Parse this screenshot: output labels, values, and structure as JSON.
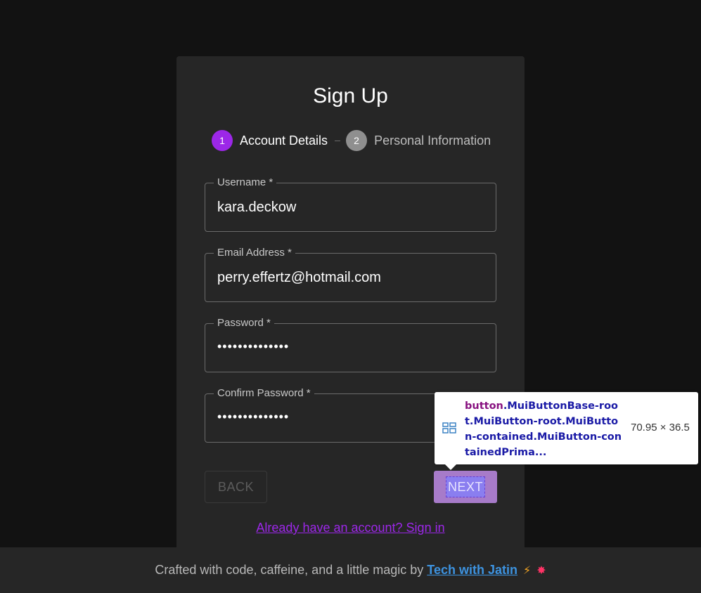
{
  "form": {
    "title": "Sign Up",
    "steps": [
      {
        "number": "1",
        "label": "Account Details"
      },
      {
        "number": "2",
        "label": "Personal Information"
      }
    ],
    "fields": {
      "username": {
        "label": "Username *",
        "value": "kara.deckow"
      },
      "email": {
        "label": "Email Address *",
        "value": "perry.effertz@hotmail.com"
      },
      "password": {
        "label": "Password *",
        "value": "••••••••••••••"
      },
      "confirm_password": {
        "label": "Confirm Password *",
        "value": "••••••••••••••"
      }
    },
    "back_label": "BACK",
    "next_label": "NEXT",
    "signin_link": "Already have an account? Sign in"
  },
  "devtools_tooltip": {
    "selector_tag": "button",
    "selector_classes": ".MuiButtonBase-root.MuiButton-root.MuiButton-contained.MuiButton-containedPrima...",
    "size": "70.95 × 36.5"
  },
  "footer": {
    "text": "Crafted with code, caffeine, and a little magic by",
    "link": "Tech with Jatin",
    "icons": [
      "lightning-icon",
      "sparkle-icon"
    ]
  },
  "colors": {
    "primary": "#9c27e8",
    "background": "#121212",
    "card": "#262626",
    "link_blue": "#3d93e0"
  }
}
